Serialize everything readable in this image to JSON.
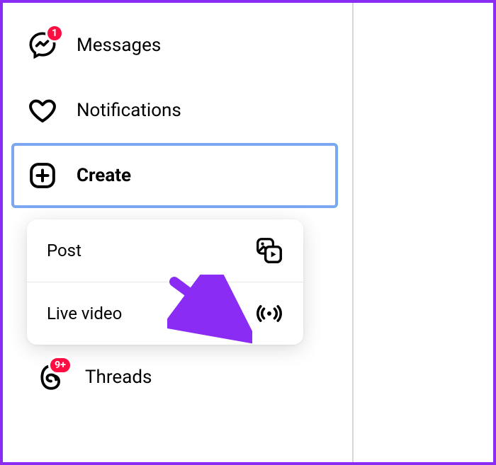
{
  "sidebar": {
    "items": [
      {
        "label": "Messages",
        "badge": "1"
      },
      {
        "label": "Notifications"
      },
      {
        "label": "Create"
      }
    ],
    "threads": {
      "label": "Threads",
      "badge": "9+"
    }
  },
  "create_menu": {
    "post": {
      "label": "Post"
    },
    "live": {
      "label": "Live video"
    }
  }
}
